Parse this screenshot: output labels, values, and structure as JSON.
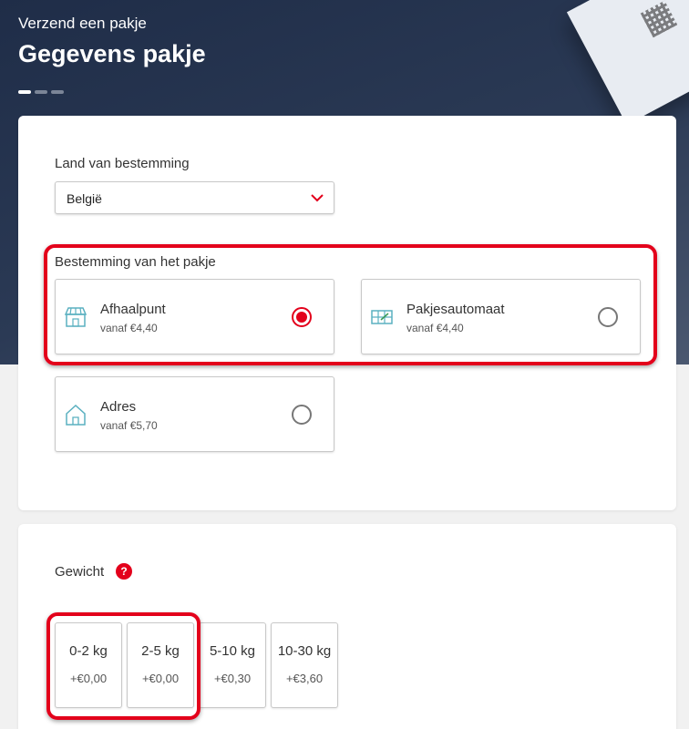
{
  "header": {
    "eyebrow": "Verzend een pakje",
    "title": "Gegevens pakje",
    "steps_total": 3,
    "step_active": 1
  },
  "destination_country": {
    "label": "Land van bestemming",
    "value": "België"
  },
  "parcel_destination": {
    "label": "Bestemming van het pakje",
    "options": [
      {
        "name": "Afhaalpunt",
        "price": "vanaf €4,40",
        "icon": "store-icon",
        "selected": true
      },
      {
        "name": "Pakjesautomaat",
        "price": "vanaf €4,40",
        "icon": "parcel-locker-icon",
        "selected": false
      },
      {
        "name": "Adres",
        "price": "vanaf €5,70",
        "icon": "house-icon",
        "selected": false
      }
    ]
  },
  "weight": {
    "label": "Gewicht",
    "help_icon": "?",
    "options": [
      {
        "range": "0-2 kg",
        "price": "+€0,00"
      },
      {
        "range": "2-5 kg",
        "price": "+€0,00"
      },
      {
        "range": "5-10 kg",
        "price": "+€0,30"
      },
      {
        "range": "10-30 kg",
        "price": "+€3,60"
      }
    ]
  },
  "colors": {
    "accent": "#e3001b",
    "hero": "#2b3a55",
    "icon_teal": "#5ab0c0"
  }
}
